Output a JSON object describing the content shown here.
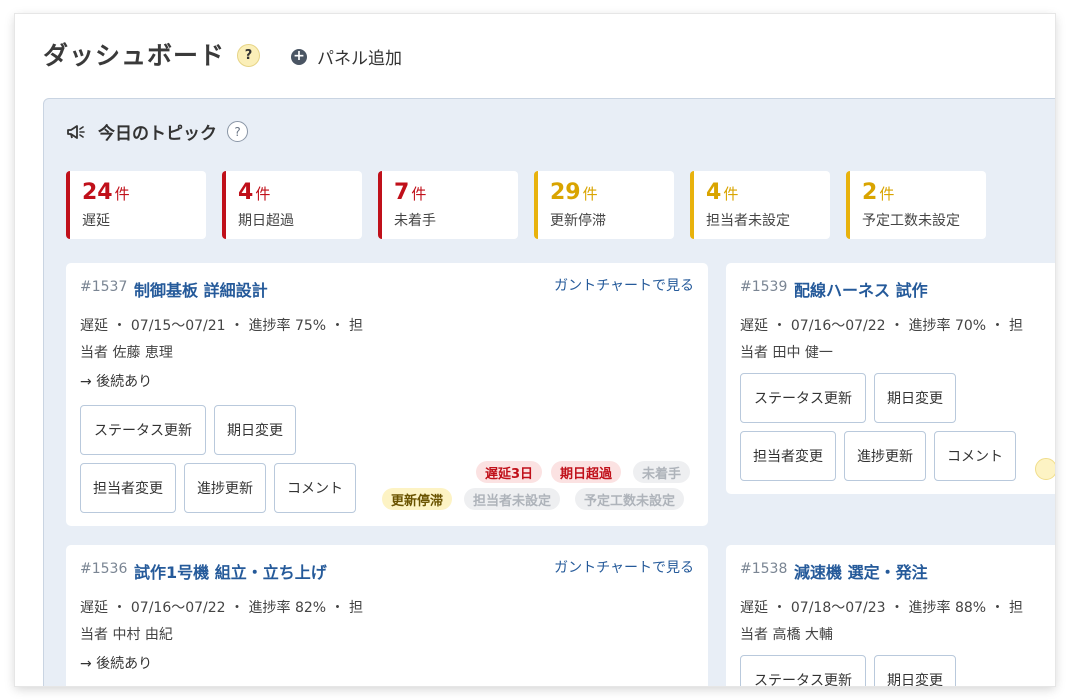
{
  "header": {
    "title": "ダッシュボード",
    "help": "?",
    "add_panel": "パネル追加"
  },
  "panel": {
    "title": "今日のトピック",
    "help": "?",
    "stats": [
      {
        "num": "24",
        "unit": "件",
        "label": "遅延",
        "color": "red"
      },
      {
        "num": "4",
        "unit": "件",
        "label": "期日超過",
        "color": "red"
      },
      {
        "num": "7",
        "unit": "件",
        "label": "未着手",
        "color": "red"
      },
      {
        "num": "29",
        "unit": "件",
        "label": "更新停滞",
        "color": "yellow"
      },
      {
        "num": "4",
        "unit": "件",
        "label": "担当者未設定",
        "color": "yellow"
      },
      {
        "num": "2",
        "unit": "件",
        "label": "予定工数未設定",
        "color": "yellow"
      }
    ]
  },
  "common": {
    "gantt_link": "ガントチャートで見る",
    "follow": "→ 後続あり",
    "btn_status": "ステータス更新",
    "btn_due": "期日変更",
    "btn_assignee": "担当者変更",
    "btn_progress": "進捗更新",
    "btn_comment": "コメント"
  },
  "cards": {
    "c1537": {
      "id": "#1537",
      "title": "制御基板 詳細設計",
      "meta1": "遅延 ・ 07/15〜07/21 ・ 進捗率 75% ・ 担",
      "meta2": "当者 佐藤 恵理",
      "tags": [
        "遅延3日",
        "期日超過",
        "未着手",
        "更新停滞",
        "担当者未設定",
        "予定工数未設定"
      ]
    },
    "c1539": {
      "id": "#1539",
      "title": "配線ハーネス 試作",
      "meta1": "遅延 ・ 07/16〜07/22 ・ 進捗率 70% ・ 担",
      "meta2": "当者 田中 健一"
    },
    "c1536": {
      "id": "#1536",
      "title": "試作1号機 組立・立ち上げ",
      "meta1": "遅延 ・ 07/16〜07/22 ・ 進捗率 82% ・ 担",
      "meta2": "当者 中村 由紀"
    },
    "c1538": {
      "id": "#1538",
      "title": "減速機 選定・発注",
      "meta1": "遅延 ・ 07/18〜07/23 ・ 進捗率 88% ・ 担",
      "meta2": "当者 高橋 大輔"
    }
  }
}
